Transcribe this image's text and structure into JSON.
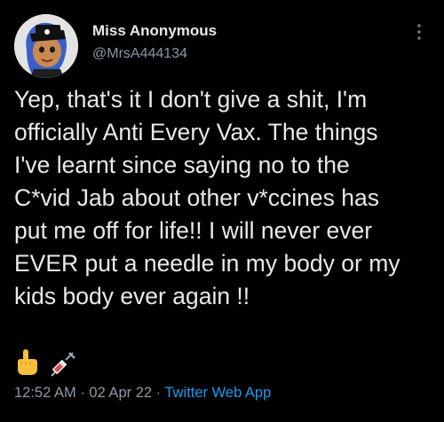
{
  "author": {
    "display_name": "Miss Anonymous",
    "handle": "@MrsA444134",
    "avatar_icon": "cartoon-avatar-icon"
  },
  "tweet": {
    "lines": [
      "Yep, that's it I don't give a shit, I'm",
      "officially Anti Every Vax. The things",
      "I've learnt since saying no to the",
      "C*vid Jab about other v*ccines has",
      "put me off for life!! I will never ever",
      "EVER put a needle in my body or my",
      "kids body ever again !!"
    ],
    "emojis": [
      "middle-finger-emoji-icon",
      "syringe-emoji-icon"
    ]
  },
  "meta": {
    "time": "12:52 AM",
    "separator": "·",
    "date": "02 Apr 22",
    "source": "Twitter Web App"
  },
  "colors": {
    "background": "#000000",
    "text": "#e7e9ea",
    "secondary": "#8b98a5",
    "link": "#1d9bf0"
  }
}
